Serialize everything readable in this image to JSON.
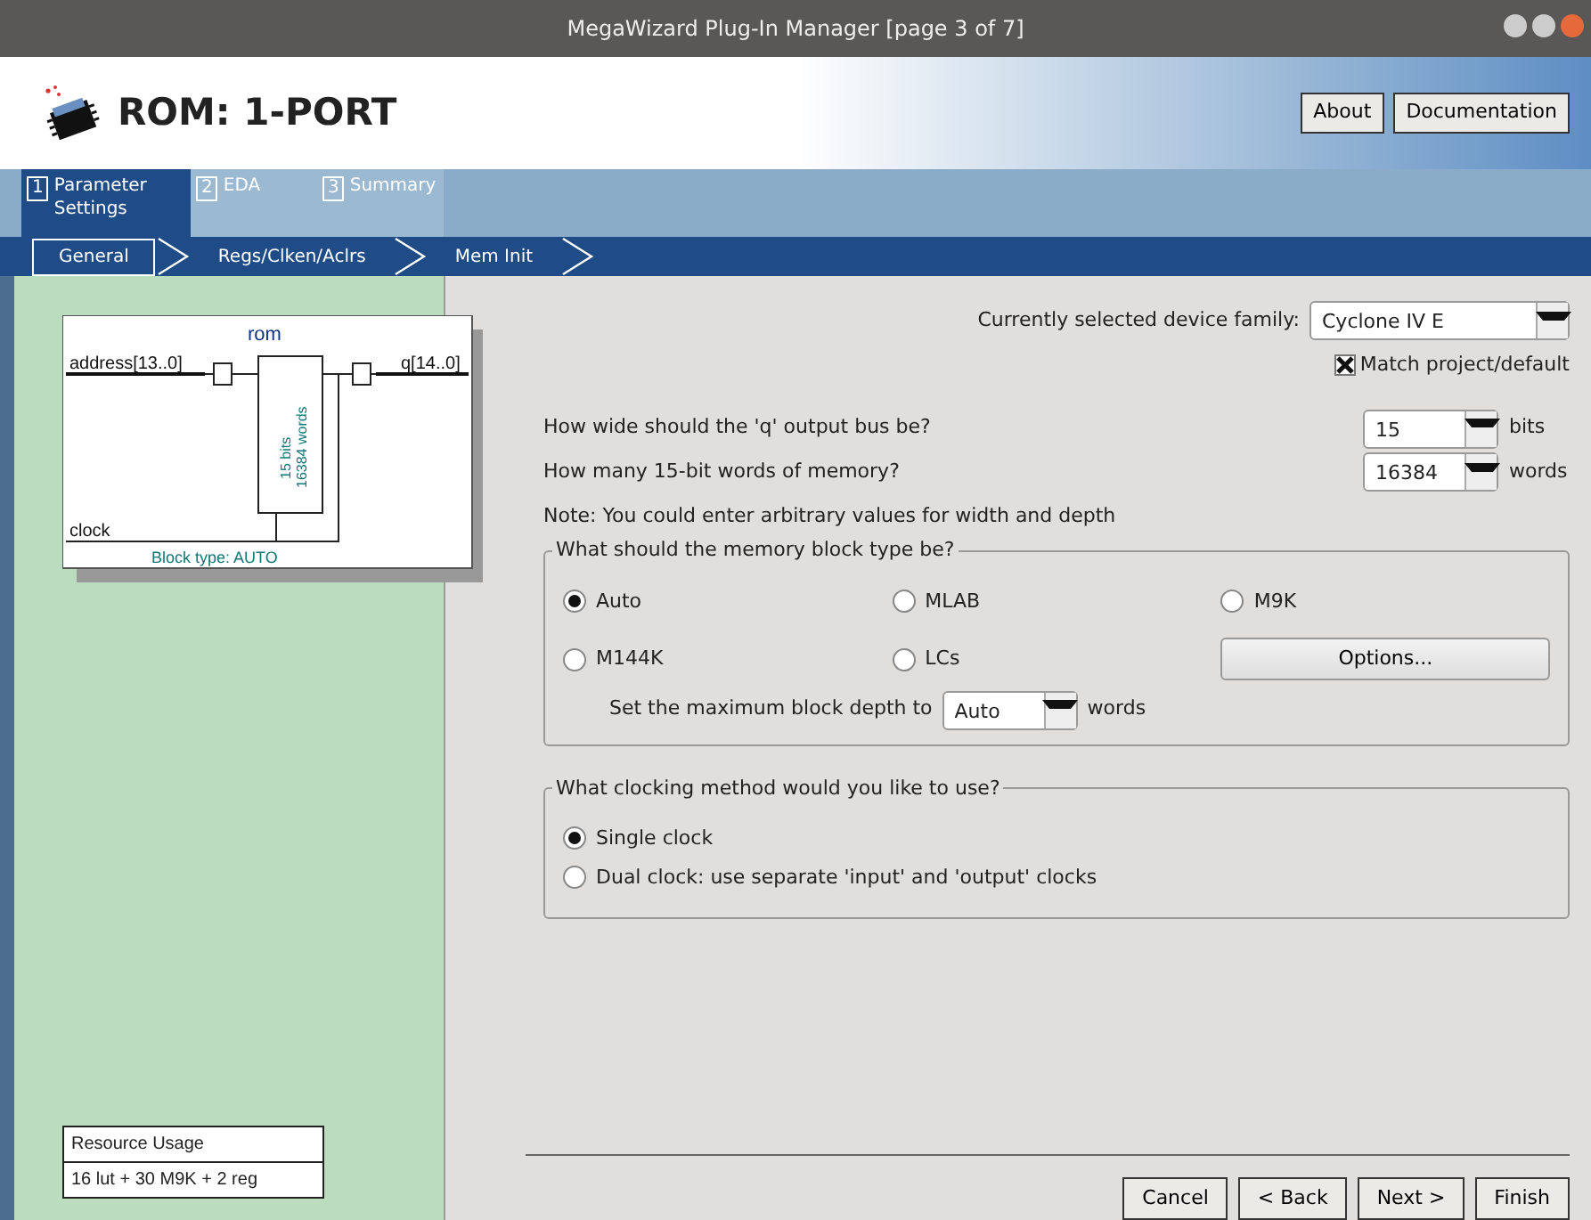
{
  "window": {
    "title": "MegaWizard Plug-In Manager [page 3 of 7]"
  },
  "header": {
    "title": "ROM: 1-PORT",
    "buttons": [
      "About",
      "Documentation"
    ]
  },
  "steps": [
    {
      "number": "1",
      "label": "Parameter Settings",
      "selected": true
    },
    {
      "number": "2",
      "label": "EDA",
      "selected": false
    },
    {
      "number": "3",
      "label": "Summary",
      "selected": false
    }
  ],
  "subtabs": [
    {
      "label": "General",
      "selected": true
    },
    {
      "label": "Regs/Clken/Aclrs",
      "selected": false
    },
    {
      "label": "Mem Init",
      "selected": false
    }
  ],
  "diagram": {
    "name": "rom",
    "input": "address[13..0]",
    "output": "q[14..0]",
    "width_label": "15 bits",
    "depth_label": "16384 words",
    "clock": "clock",
    "block_type": "Block type: AUTO"
  },
  "resource": {
    "title": "Resource Usage",
    "value": "16 lut + 30 M9K + 2 reg"
  },
  "device": {
    "label": "Currently selected device family:",
    "value": "Cyclone IV E",
    "match": {
      "label": "Match project/default",
      "checked": true
    }
  },
  "fields": [
    {
      "label": "How wide should the 'q' output bus be?",
      "value": "15",
      "unit": "bits"
    },
    {
      "label": "How many 15-bit words of memory?",
      "value": "16384",
      "unit": "words"
    }
  ],
  "note": "Note: You could enter arbitrary values for width and depth",
  "block_group": {
    "title": "What should the memory block type be?",
    "options": [
      {
        "label": "Auto",
        "selected": true
      },
      {
        "label": "MLAB",
        "selected": false
      },
      {
        "label": "M9K",
        "selected": false
      },
      {
        "label": "M144K",
        "selected": false
      },
      {
        "label": "LCs",
        "selected": false
      }
    ],
    "options_button": "Options...",
    "depth": {
      "label": "Set the maximum block depth to",
      "value": "Auto",
      "unit": "words"
    }
  },
  "clock_group": {
    "title": "What clocking method would you like to use?",
    "options": [
      {
        "label": "Single clock",
        "selected": true
      },
      {
        "label": "Dual clock: use separate 'input' and 'output' clocks",
        "selected": false
      }
    ]
  },
  "footer": {
    "buttons": [
      "Cancel",
      "< Back",
      "Next >",
      "Finish"
    ]
  }
}
